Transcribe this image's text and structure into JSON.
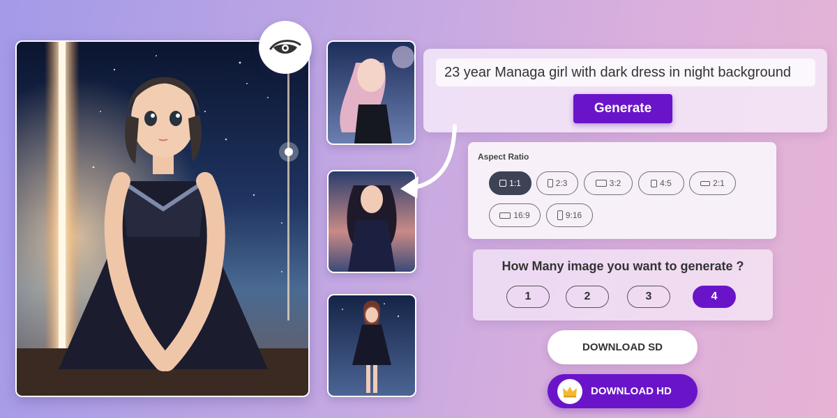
{
  "prompt": {
    "value": "23 year Managa girl with dark dress in night background",
    "generate_label": "Generate"
  },
  "aspect_ratio": {
    "title": "Aspect Ratio",
    "options": [
      "1:1",
      "2:3",
      "3:2",
      "4:5",
      "2:1",
      "16:9",
      "9:16"
    ],
    "selected": "1:1"
  },
  "image_count": {
    "question": "How Many image you want to generate ?",
    "options": [
      "1",
      "2",
      "3",
      "4"
    ],
    "selected": "4"
  },
  "downloads": {
    "sd_label": "DOWNLOAD SD",
    "hd_label": "DOWNLOAD HD"
  },
  "icons": {
    "preview": "eye-icon",
    "premium": "crown-icon"
  },
  "colors": {
    "accent": "#6a14c9",
    "active_ratio": "#3d4355",
    "crown": "#f5b82e"
  }
}
